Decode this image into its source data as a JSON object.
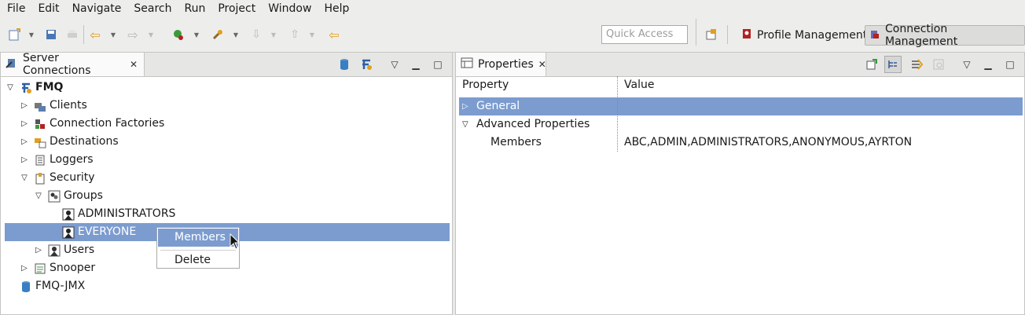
{
  "menu": [
    "File",
    "Edit",
    "Navigate",
    "Search",
    "Run",
    "Project",
    "Window",
    "Help"
  ],
  "toolbar": {
    "quick_access_placeholder": "Quick Access",
    "perspectives": [
      {
        "label": "Profile Management",
        "active": false
      },
      {
        "label": "Connection Management",
        "active": true
      }
    ]
  },
  "left_panel": {
    "tab_title": "Server Connections",
    "tree": [
      {
        "label": "FMQ",
        "bold": true
      },
      {
        "label": "Clients"
      },
      {
        "label": "Connection Factories"
      },
      {
        "label": "Destinations"
      },
      {
        "label": "Loggers"
      },
      {
        "label": "Security"
      },
      {
        "label": "Groups"
      },
      {
        "label": "ADMINISTRATORS"
      },
      {
        "label": "EVERYONE",
        "selected": true
      },
      {
        "label": "Users"
      },
      {
        "label": "Snooper"
      },
      {
        "label": "FMQ-JMX"
      }
    ],
    "context_menu": [
      "Members",
      "Delete"
    ]
  },
  "right_panel": {
    "tab_title": "Properties",
    "columns": [
      "Property",
      "Value"
    ],
    "rows": [
      {
        "property": "General",
        "value": "",
        "selected": true
      },
      {
        "property": "Advanced Properties",
        "value": ""
      },
      {
        "property": "Members",
        "value": "ABC,ADMIN,ADMINISTRATORS,ANONYMOUS,AYRTON"
      }
    ]
  },
  "colors": {
    "selection": "#7c9ccf",
    "accent_red": "#b22222",
    "accent_orange": "#e0a020"
  }
}
